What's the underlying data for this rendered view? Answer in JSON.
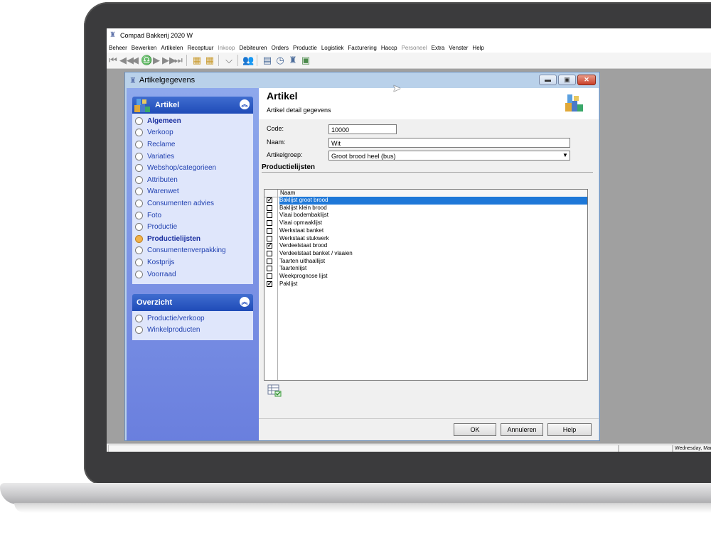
{
  "app": {
    "title": "Compad Bakkerij 2020 W",
    "menu": [
      {
        "label": "Beheer",
        "disabled": false
      },
      {
        "label": "Bewerken",
        "disabled": false
      },
      {
        "label": "Artikelen",
        "disabled": false
      },
      {
        "label": "Receptuur",
        "disabled": false
      },
      {
        "label": "Inkoop",
        "disabled": true
      },
      {
        "label": "Debiteuren",
        "disabled": false
      },
      {
        "label": "Orders",
        "disabled": false
      },
      {
        "label": "Productie",
        "disabled": false
      },
      {
        "label": "Logistiek",
        "disabled": false
      },
      {
        "label": "Facturering",
        "disabled": false
      },
      {
        "label": "Haccp",
        "disabled": false
      },
      {
        "label": "Personeel",
        "disabled": true
      },
      {
        "label": "Extra",
        "disabled": false
      },
      {
        "label": "Venster",
        "disabled": false
      },
      {
        "label": "Help",
        "disabled": false
      }
    ],
    "status_date": "Wednesday, March"
  },
  "dialog": {
    "title": "Artikelgegevens",
    "sidebar": {
      "artikel_panel": {
        "title": "Artikel",
        "items": [
          {
            "label": "Algemeen",
            "bold": true,
            "selected": false
          },
          {
            "label": "Verkoop",
            "bold": false,
            "selected": false
          },
          {
            "label": "Reclame",
            "bold": false,
            "selected": false
          },
          {
            "label": "Variaties",
            "bold": false,
            "selected": false
          },
          {
            "label": "Webshop/categorieen",
            "bold": false,
            "selected": false
          },
          {
            "label": "Attributen",
            "bold": false,
            "selected": false
          },
          {
            "label": "Warenwet",
            "bold": false,
            "selected": false
          },
          {
            "label": "Consumenten advies",
            "bold": false,
            "selected": false
          },
          {
            "label": "Foto",
            "bold": false,
            "selected": false
          },
          {
            "label": "Productie",
            "bold": false,
            "selected": false
          },
          {
            "label": "Productielijsten",
            "bold": true,
            "selected": true
          },
          {
            "label": "Consumentenverpakking",
            "bold": false,
            "selected": false
          },
          {
            "label": "Kostprijs",
            "bold": false,
            "selected": false
          },
          {
            "label": "Voorraad",
            "bold": false,
            "selected": false
          }
        ]
      },
      "overzicht_panel": {
        "title": "Overzicht",
        "items": [
          {
            "label": "Productie/verkoop"
          },
          {
            "label": "Winkelproducten"
          }
        ]
      }
    },
    "header": {
      "title": "Artikel",
      "subtitle": "Artikel detail gegevens"
    },
    "form": {
      "code_label": "Code:",
      "code_value": "10000",
      "naam_label": "Naam:",
      "naam_value": "Wit",
      "groep_label": "Artikelgroep:",
      "groep_value": "Groot brood heel (bus)"
    },
    "section_title": "Productielijsten",
    "grid": {
      "column_header": "Naam",
      "rows": [
        {
          "name": "Baklijst groot brood",
          "checked": true,
          "selected": true
        },
        {
          "name": "Baklijst klein brood",
          "checked": false,
          "selected": false
        },
        {
          "name": "Vlaai bodembaklijst",
          "checked": false,
          "selected": false
        },
        {
          "name": "Vlaai opmaaklijst",
          "checked": false,
          "selected": false
        },
        {
          "name": "Werkstaat banket",
          "checked": false,
          "selected": false
        },
        {
          "name": "Werkstaat stukwerk",
          "checked": false,
          "selected": false
        },
        {
          "name": "Verdeelstaat brood",
          "checked": true,
          "selected": false
        },
        {
          "name": "Verdeelstaat banket / vlaaien",
          "checked": false,
          "selected": false
        },
        {
          "name": "Taarten uithaallijst",
          "checked": false,
          "selected": false
        },
        {
          "name": "Taartenlijst",
          "checked": false,
          "selected": false
        },
        {
          "name": "Weekprognose lijst",
          "checked": false,
          "selected": false
        },
        {
          "name": "Paklijst",
          "checked": true,
          "selected": false
        }
      ]
    },
    "buttons": {
      "ok": "OK",
      "cancel": "Annuleren",
      "help": "Help"
    }
  }
}
